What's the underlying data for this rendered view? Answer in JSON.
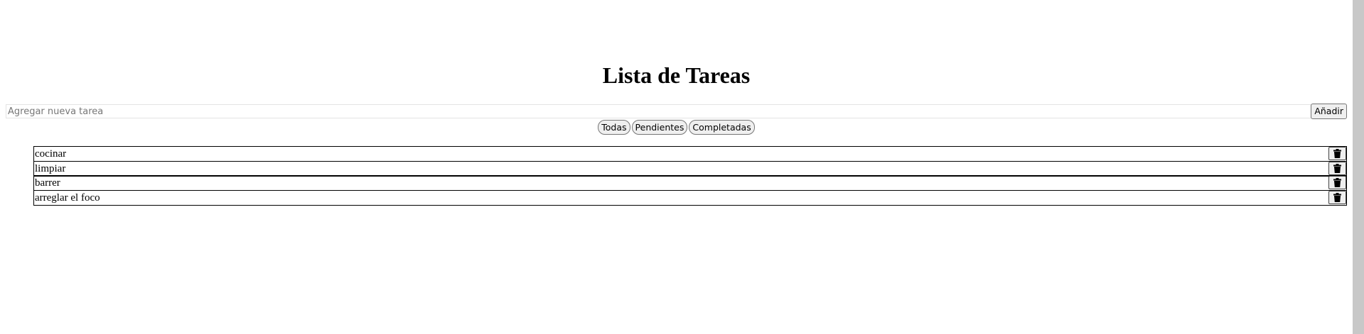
{
  "header": {
    "title": "Lista de Tareas"
  },
  "add_form": {
    "placeholder": "Agregar nueva tarea",
    "value": "",
    "add_label": "Añadir"
  },
  "filters": [
    {
      "label": "Todas"
    },
    {
      "label": "Pendientes"
    },
    {
      "label": "Completadas"
    }
  ],
  "tasks": [
    {
      "text": "cocinar",
      "delete_icon": "trash-icon"
    },
    {
      "text": "limpiar",
      "delete_icon": "trash-icon"
    },
    {
      "text": "barrer",
      "delete_icon": "trash-icon"
    },
    {
      "text": "arreglar el foco",
      "delete_icon": "trash-icon"
    }
  ]
}
